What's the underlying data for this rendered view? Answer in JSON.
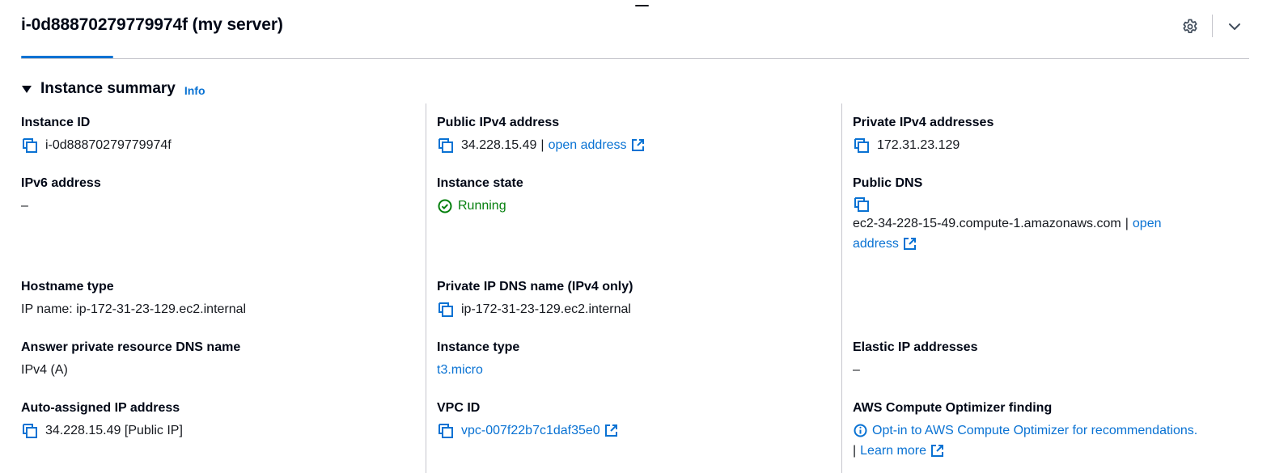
{
  "header": {
    "title": "i-0d88870279779974f (my server)",
    "settings_icon": "gear-icon",
    "collapse_icon": "chevron-down-icon"
  },
  "section": {
    "title": "Instance summary",
    "info_label": "Info",
    "caret_icon": "caret-down-icon"
  },
  "fields": {
    "instance_id": {
      "label": "Instance ID",
      "value": "i-0d88870279779974f"
    },
    "public_ipv4": {
      "label": "Public IPv4 address",
      "value": "34.228.15.49",
      "separator": "|",
      "link": "open address"
    },
    "private_ipv4": {
      "label": "Private IPv4 addresses",
      "value": "172.31.23.129"
    },
    "ipv6": {
      "label": "IPv6 address",
      "value": "–"
    },
    "instance_state": {
      "label": "Instance state",
      "value": "Running",
      "color": "#037f0c"
    },
    "public_dns": {
      "label": "Public DNS",
      "value": "ec2-34-228-15-49.compute-1.amazonaws.com",
      "separator": "|",
      "link_part1": "open",
      "link_part2": "address"
    },
    "hostname_type": {
      "label": "Hostname type",
      "value": "IP name: ip-172-31-23-129.ec2.internal"
    },
    "private_ip_dns": {
      "label": "Private IP DNS name (IPv4 only)",
      "value": "ip-172-31-23-129.ec2.internal"
    },
    "answer_private_dns": {
      "label": "Answer private resource DNS name",
      "value": "IPv4 (A)"
    },
    "instance_type": {
      "label": "Instance type",
      "value": "t3.micro"
    },
    "elastic_ip": {
      "label": "Elastic IP addresses",
      "value": "–"
    },
    "auto_assigned_ip": {
      "label": "Auto-assigned IP address",
      "value": "34.228.15.49 [Public IP]"
    },
    "vpc_id": {
      "label": "VPC ID",
      "value": "vpc-007f22b7c1daf35e0"
    },
    "compute_optimizer": {
      "label": "AWS Compute Optimizer finding",
      "value": "Opt-in to AWS Compute Optimizer for recommendations.",
      "separator": "|",
      "link": "Learn more"
    }
  },
  "colors": {
    "link": "#0972d3",
    "success": "#037f0c",
    "text": "#16191f",
    "divider": "#c6c6cd"
  }
}
